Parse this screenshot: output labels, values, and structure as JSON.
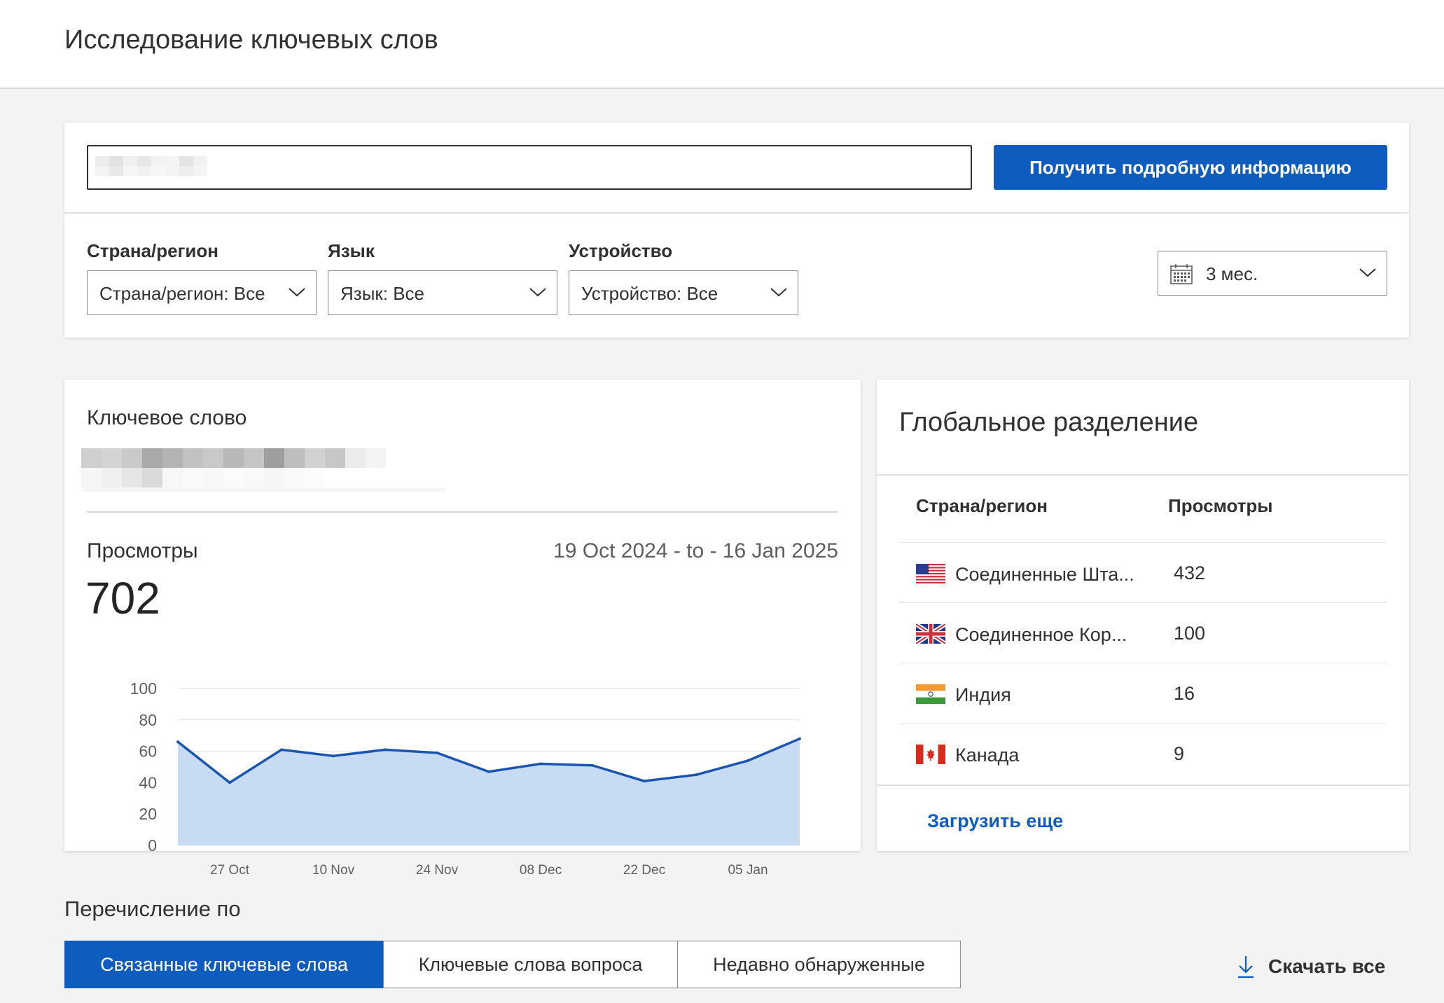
{
  "header": {
    "title": "Исследование ключевых слов"
  },
  "search": {
    "placeholder": "",
    "button_label": "Получить подробную информацию"
  },
  "filters": [
    {
      "label": "Страна/регион",
      "value": "Страна/регион: Все"
    },
    {
      "label": "Язык",
      "value": "Язык: Все"
    },
    {
      "label": "Устройство",
      "value": "Устройство: Все"
    }
  ],
  "date_filter": {
    "value": "3 мес.",
    "icon": "calendar-icon"
  },
  "keyword_card": {
    "label": "Ключевое слово",
    "views_label": "Просмотры",
    "views_total": "702",
    "date_range": "19 Oct 2024 - to - 16 Jan 2025"
  },
  "chart_data": {
    "type": "area",
    "x": [
      "20 Oct",
      "27 Oct",
      "03 Nov",
      "10 Nov",
      "17 Nov",
      "24 Nov",
      "01 Dec",
      "08 Dec",
      "15 Dec",
      "22 Dec",
      "29 Dec",
      "05 Jan",
      "12 Jan"
    ],
    "values": [
      66,
      40,
      61,
      57,
      61,
      59,
      47,
      52,
      51,
      41,
      45,
      54,
      68
    ],
    "x_tick_labels": [
      "27 Oct",
      "10 Nov",
      "24 Nov",
      "08 Dec",
      "22 Dec",
      "05 Jan"
    ],
    "y_ticks": [
      0,
      20,
      40,
      60,
      80,
      100
    ],
    "ylim": [
      0,
      100
    ],
    "grid": true,
    "line_color": "#1a56b0",
    "fill_color": "#c7dcf2"
  },
  "global_card": {
    "title": "Глобальное разделение",
    "col_country": "Страна/регион",
    "col_views": "Просмотры",
    "rows": [
      {
        "country": "Соединенные Шта...",
        "views": "432",
        "flag": "us-flag-icon"
      },
      {
        "country": "Соединенное Кор...",
        "views": "100",
        "flag": "uk-flag-icon"
      },
      {
        "country": "Индия",
        "views": "16",
        "flag": "india-flag-icon"
      },
      {
        "country": "Канада",
        "views": "9",
        "flag": "canada-flag-icon"
      }
    ],
    "load_more": "Загрузить еще"
  },
  "list_by": {
    "label": "Перечисление по",
    "tabs": [
      "Связанные ключевые слова",
      "Ключевые слова вопроса",
      "Недавно обнаруженные"
    ],
    "active_tab": 0,
    "download_label": "Скачать все"
  },
  "colors": {
    "accent": "#0f5cbf",
    "page_bg": "#f3f3f3"
  }
}
